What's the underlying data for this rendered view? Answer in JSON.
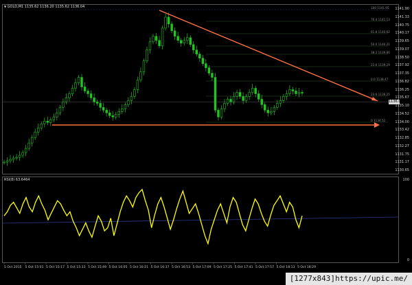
{
  "chart_window": {
    "symbol_line": "GOLD,M1 1135.62 1136.20 1135.62 1136.04",
    "rsi_title": "RSI(8) 63.6464",
    "current_price": "1136.04",
    "price_labels": [
      "1141.90",
      "1141.33",
      "1140.75",
      "1140.17",
      "1139.65",
      "1139.07",
      "1138.50",
      "1137.92",
      "1137.35",
      "1136.82",
      "1136.25",
      "1135.67",
      "1135.10",
      "1134.52",
      "1134.00",
      "1133.42",
      "1132.85",
      "1132.27",
      "1131.75",
      "1131.17",
      "1130.65"
    ],
    "rsi_labels": [
      "100",
      "0"
    ],
    "time_labels": [
      "5 Oct 2015",
      "5 Oct 15:01",
      "5 Oct 15:17",
      "5 Oct 15:33",
      "5 Oct 15:49",
      "5 Oct 16:05",
      "5 Oct 16:21",
      "5 Oct 16:37",
      "5 Oct 16:53",
      "5 Oct 17:09",
      "5 Oct 17:25",
      "5 Oct 17:41",
      "5 Oct 17:57",
      "5 Oct 18:13",
      "5 Oct 18:29"
    ],
    "fib_labels": [
      "100 1141.95",
      "76.4 1141.13",
      "61.8 1140.62",
      "50.0 1140.21",
      "38.2 1139.80",
      "23.6 1139.29",
      "0.0 1138.47",
      "23.6 1136.25",
      "0 1134.52"
    ],
    "colors": {
      "candle": "#22c322",
      "rsi": "#ffff00",
      "trendline": "#ff7043",
      "grid": "#3a3a3a",
      "background": "#000000"
    }
  },
  "watermark": "[1277x843]https://upic.me/",
  "chart_data": {
    "type": "line",
    "ylim": [
      1130.4,
      1142.2
    ],
    "ylabel": "",
    "xlabel": "",
    "series": [
      {
        "values": [
          1131.0,
          1131.1,
          1131.2,
          1131.3,
          1131.35,
          1131.5,
          1131.7,
          1132.0,
          1132.4,
          1132.8,
          1133.2,
          1133.5,
          1133.8,
          1134.0,
          1133.9,
          1134.1,
          1134.3,
          1134.6,
          1135.0,
          1135.4,
          1135.7,
          1136.0,
          1136.4,
          1136.8,
          1137.2,
          1136.5,
          1136.2,
          1136.0,
          1135.7,
          1135.4,
          1135.3,
          1135.0,
          1134.8,
          1134.6,
          1134.4,
          1134.3,
          1134.5,
          1134.7,
          1134.9,
          1135.2,
          1135.5,
          1135.8,
          1136.3,
          1137.0,
          1137.6,
          1138.4,
          1139.2,
          1139.8,
          1140.2,
          1139.9,
          1139.5,
          1140.8,
          1141.6,
          1141.1,
          1140.6,
          1140.2,
          1139.9,
          1139.7,
          1139.9,
          1140.1,
          1139.6,
          1139.2,
          1138.9,
          1138.6,
          1138.2,
          1137.9,
          1137.5,
          1137.2,
          1134.8,
          1134.3,
          1134.9,
          1135.3,
          1135.6,
          1135.4,
          1135.8,
          1136.1,
          1135.8,
          1135.5,
          1135.8,
          1136.1,
          1136.4,
          1136.0,
          1135.6,
          1135.2,
          1134.8,
          1134.6,
          1134.7,
          1135.0,
          1135.3,
          1135.5,
          1135.8,
          1136.0,
          1136.3,
          1136.2,
          1136.0,
          1136.1,
          1136.04
        ]
      }
    ]
  },
  "rsi_data": {
    "ylim": [
      0,
      100
    ],
    "values": [
      55,
      60,
      68,
      72,
      65,
      58,
      70,
      78,
      66,
      60,
      72,
      80,
      70,
      62,
      50,
      58,
      66,
      74,
      70,
      62,
      55,
      60,
      48,
      40,
      30,
      38,
      46,
      36,
      28,
      42,
      55,
      48,
      36,
      40,
      52,
      30,
      45,
      60,
      72,
      80,
      74,
      66,
      78,
      84,
      88,
      74,
      62,
      40,
      56,
      70,
      78,
      66,
      52,
      38,
      50,
      64,
      76,
      86,
      72,
      58,
      64,
      70,
      58,
      44,
      30,
      20,
      38,
      50,
      62,
      70,
      58,
      46,
      66,
      78,
      72,
      58,
      44,
      36,
      50,
      64,
      76,
      70,
      58,
      48,
      42,
      56,
      68,
      74,
      80,
      70,
      60,
      72,
      66,
      50,
      40,
      55
    ]
  }
}
